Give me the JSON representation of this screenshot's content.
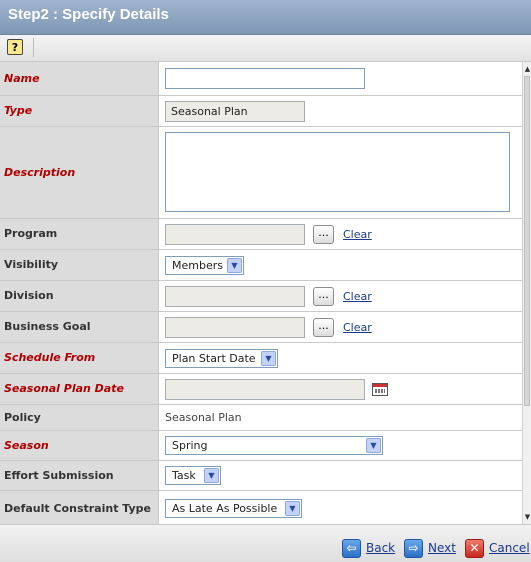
{
  "header": {
    "title": "Step2 : Specify Details"
  },
  "toolbar": {
    "help_icon": "?"
  },
  "form": {
    "name": {
      "label": "Name",
      "value": ""
    },
    "type": {
      "label": "Type",
      "value": "Seasonal Plan"
    },
    "description": {
      "label": "Description",
      "value": ""
    },
    "program": {
      "label": "Program",
      "value": "",
      "button": "...",
      "clear": "Clear"
    },
    "visibility": {
      "label": "Visibility",
      "value": "Members"
    },
    "division": {
      "label": "Division",
      "value": "",
      "button": "...",
      "clear": "Clear"
    },
    "business_goal": {
      "label": "Business Goal",
      "value": "",
      "button": "...",
      "clear": "Clear"
    },
    "schedule_from": {
      "label": "Schedule From",
      "value": "Plan Start Date"
    },
    "seasonal_plan_date": {
      "label": "Seasonal Plan Date",
      "value": ""
    },
    "policy": {
      "label": "Policy",
      "value": "Seasonal Plan"
    },
    "season": {
      "label": "Season",
      "value": "Spring"
    },
    "effort_submission": {
      "label": "Effort Submission",
      "value": "Task"
    },
    "default_constraint_type": {
      "label": "Default Constraint Type",
      "value": "As Late As Possible"
    }
  },
  "footer": {
    "back": "Back",
    "next": "Next",
    "cancel": "Cancel"
  },
  "colors": {
    "required_label": "#b00000",
    "header_bg": "#8ea4c2",
    "link": "#1a3a8a"
  }
}
